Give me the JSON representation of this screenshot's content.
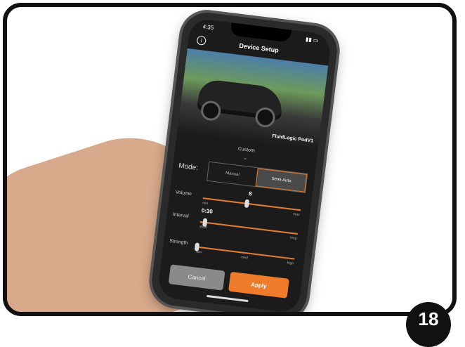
{
  "status": {
    "time": "4:35"
  },
  "header": {
    "title": "Device Setup"
  },
  "hero": {
    "device_name": "FluidLogic PodV1"
  },
  "preset": {
    "label": "Custom"
  },
  "mode": {
    "label": "Mode:",
    "options": [
      "Manual",
      "Semi-Auto"
    ],
    "selected": "Semi-Auto"
  },
  "volume": {
    "label": "Volume",
    "value": "8",
    "min_label": "min",
    "max_label": "max",
    "level": 0.45
  },
  "interval": {
    "label": "Interval",
    "value": "0:30",
    "min_label": "short",
    "max_label": "long",
    "level": 0.05
  },
  "strength": {
    "label": "Strength",
    "min_label": "low",
    "mid_label": "med",
    "max_label": "high",
    "level": 0.0
  },
  "actions": {
    "cancel_label": "Cancel",
    "apply_label": "Apply"
  },
  "page": {
    "badge": "18"
  },
  "colors": {
    "accent": "#ee7c2a"
  }
}
